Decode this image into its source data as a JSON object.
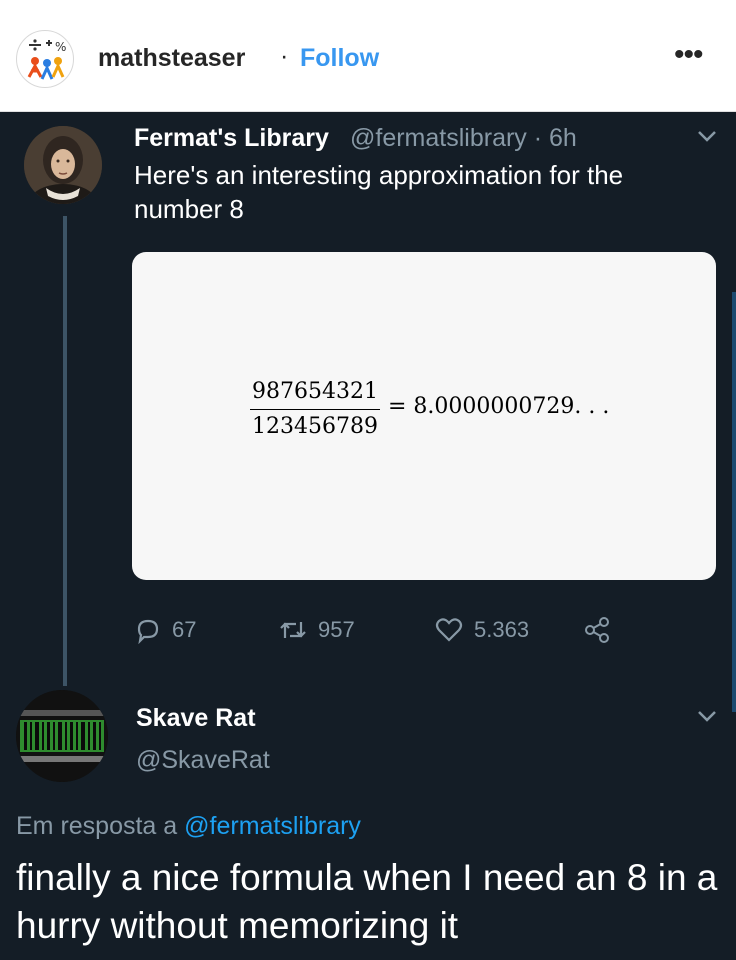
{
  "instagram": {
    "username": "mathsteaser",
    "separator": "·",
    "follow_label": "Follow",
    "more_label": "•••"
  },
  "tweet": {
    "author_name": "Fermat's Library",
    "handle_time": "@fermatslibrary · 6h",
    "text": "Here's an interesting approximation for the number 8",
    "image": {
      "numerator": "987654321",
      "denominator": "123456789",
      "equals": "= 8.0000000729. . ."
    },
    "actions": {
      "replies": "67",
      "retweets": "957",
      "likes": "5.363"
    }
  },
  "reply": {
    "author_name": "Skave Rat",
    "handle": "@SkaveRat",
    "reply_prefix": "Em resposta a",
    "reply_to": "@fermatslibrary",
    "text": "finally a nice formula when I need an 8 in a hurry without memorizing it"
  },
  "colors": {
    "background": "#141d26",
    "link": "#1da1f2",
    "muted": "#8899a6",
    "instagram_follow": "#3897f0"
  },
  "icons": [
    "mathsteaser-logo-icon",
    "chevron-down-icon",
    "reply-icon",
    "retweet-icon",
    "like-icon",
    "share-icon"
  ]
}
